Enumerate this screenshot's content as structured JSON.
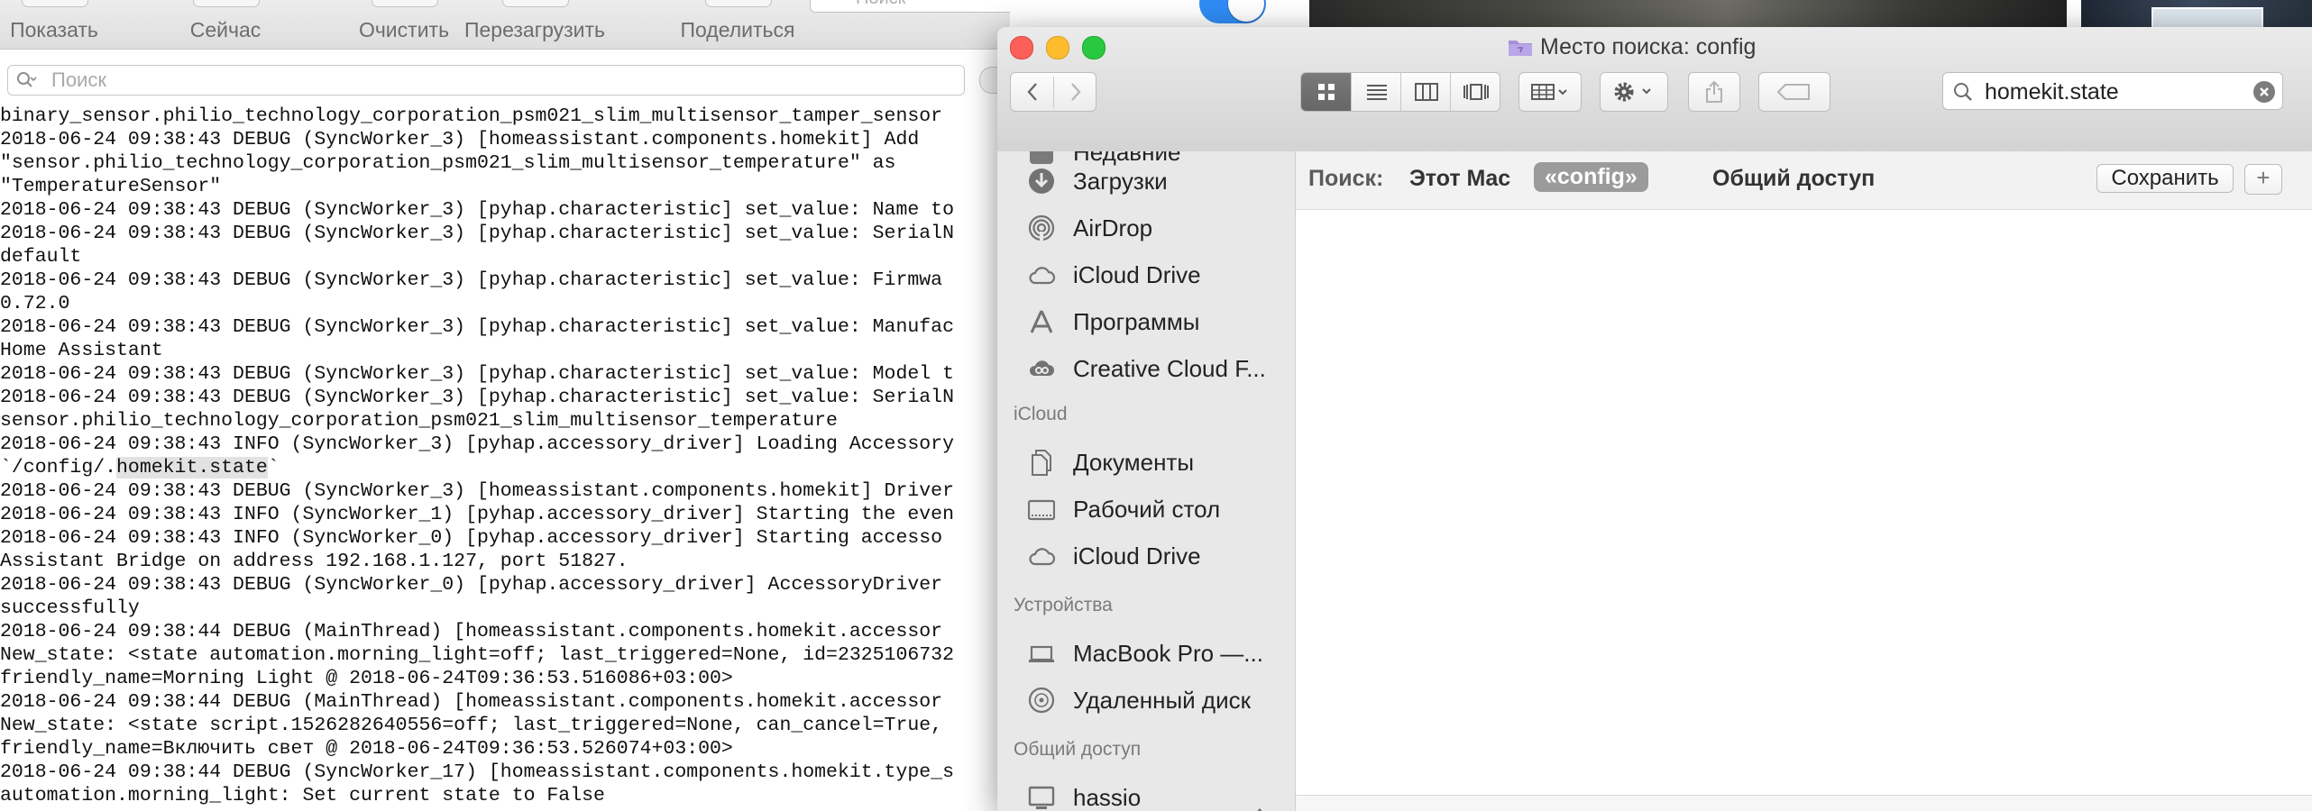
{
  "console": {
    "toolbar": [
      {
        "label": "Показать"
      },
      {
        "label": "Сейчас"
      },
      {
        "label": "Очистить"
      },
      {
        "label": "Перезагрузить"
      },
      {
        "label": "Поделиться"
      }
    ],
    "top_search_placeholder": "Поиск",
    "filter_placeholder": "Поиск",
    "log_lines": [
      "binary_sensor.philio_technology_corporation_psm021_slim_multisensor_tamper_sensor",
      "2018-06-24 09:38:43 DEBUG (SyncWorker_3) [homeassistant.components.homekit] Add",
      "\"sensor.philio_technology_corporation_psm021_slim_multisensor_temperature\" as",
      "\"TemperatureSensor\"",
      "2018-06-24 09:38:43 DEBUG (SyncWorker_3) [pyhap.characteristic] set_value: Name to",
      "2018-06-24 09:38:43 DEBUG (SyncWorker_3) [pyhap.characteristic] set_value: SerialN",
      "default",
      "2018-06-24 09:38:43 DEBUG (SyncWorker_3) [pyhap.characteristic] set_value: Firmwa",
      "0.72.0",
      "2018-06-24 09:38:43 DEBUG (SyncWorker_3) [pyhap.characteristic] set_value: Manufac",
      "Home Assistant",
      "2018-06-24 09:38:43 DEBUG (SyncWorker_3) [pyhap.characteristic] set_value: Model t",
      "2018-06-24 09:38:43 DEBUG (SyncWorker_3) [pyhap.characteristic] set_value: SerialN",
      "sensor.philio_technology_corporation_psm021_slim_multisensor_temperature",
      "2018-06-24 09:38:43 INFO (SyncWorker_3) [pyhap.accessory_driver] Loading Accessory",
      "",
      "2018-06-24 09:38:43 DEBUG (SyncWorker_3) [homeassistant.components.homekit] Driver",
      "2018-06-24 09:38:43 INFO (SyncWorker_1) [pyhap.accessory_driver] Starting the even",
      "2018-06-24 09:38:43 INFO (SyncWorker_0) [pyhap.accessory_driver] Starting accesso",
      "Assistant Bridge on address 192.168.1.127, port 51827.",
      "2018-06-24 09:38:43 DEBUG (SyncWorker_0) [pyhap.accessory_driver] AccessoryDriver",
      "successfully",
      "2018-06-24 09:38:44 DEBUG (MainThread) [homeassistant.components.homekit.accessor",
      "New_state: <state automation.morning_light=off; last_triggered=None, id=2325106732",
      "friendly_name=Morning Light @ 2018-06-24T09:36:53.516086+03:00>",
      "2018-06-24 09:38:44 DEBUG (MainThread) [homeassistant.components.homekit.accessor",
      "New_state: <state script.1526282640556=off; last_triggered=None, can_cancel=True, ",
      "friendly_name=Включить свет @ 2018-06-24T09:36:53.526074+03:00>",
      "2018-06-24 09:38:44 DEBUG (SyncWorker_17) [homeassistant.components.homekit.type_s",
      "automation.morning_light: Set current state to False"
    ],
    "path_line": {
      "before": "`/config/.",
      "highlight": "homekit.state",
      "after": "`"
    }
  },
  "finder": {
    "title": "Место поиска: config",
    "search_value": "homekit.state",
    "scope": {
      "label": "Поиск:",
      "this_mac": "Этот Mac",
      "config": "«config»",
      "shared": "Общий доступ",
      "save": "Сохранить",
      "add": "+"
    },
    "sidebar": {
      "cut_item": "Недавние",
      "favorites": [
        {
          "label": "Загрузки",
          "icon": "downloads-icon"
        },
        {
          "label": "AirDrop",
          "icon": "airdrop-icon"
        },
        {
          "label": "iCloud Drive",
          "icon": "cloud-icon"
        },
        {
          "label": "Программы",
          "icon": "applications-icon"
        },
        {
          "label": "Creative Cloud F...",
          "icon": "creative-cloud-icon"
        }
      ],
      "icloud_heading": "iCloud",
      "icloud": [
        {
          "label": "Документы",
          "icon": "documents-icon"
        },
        {
          "label": "Рабочий стол",
          "icon": "desktop-icon"
        },
        {
          "label": "iCloud Drive",
          "icon": "cloud-icon"
        }
      ],
      "devices_heading": "Устройства",
      "devices": [
        {
          "label": "MacBook Pro —...",
          "icon": "laptop-icon"
        },
        {
          "label": "Удаленный диск",
          "icon": "remote-disc-icon"
        }
      ],
      "shared_heading": "Общий доступ",
      "shared": [
        {
          "label": "hassio",
          "icon": "server-icon"
        }
      ]
    }
  },
  "colors": {
    "close": "#fc5f57",
    "minimize": "#fdbc2e",
    "zoom": "#28c840",
    "toggle_on": "#2f8cf4",
    "scope_active": "#9b9b9b"
  }
}
